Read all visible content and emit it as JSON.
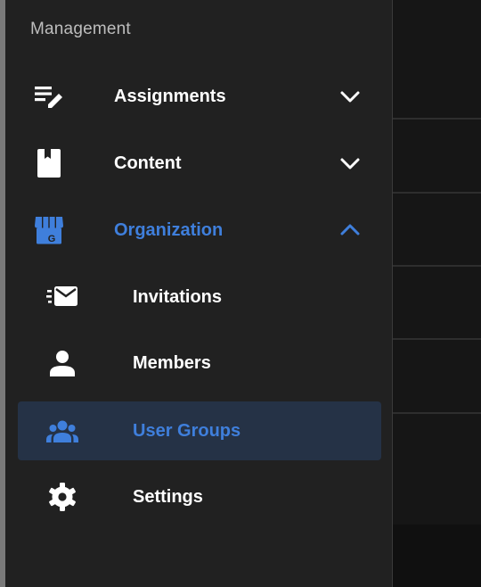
{
  "colors": {
    "accent": "#3f7fdc",
    "active_bg": "#253246",
    "drawer_bg": "#212121",
    "text": "#ffffff",
    "section_title": "#bdbdbd"
  },
  "drawer": {
    "section_title": "Management",
    "items": [
      {
        "label": "Assignments",
        "icon": "assignment-edit-icon",
        "expanded": false
      },
      {
        "label": "Content",
        "icon": "bookmark-icon",
        "expanded": false
      },
      {
        "label": "Organization",
        "icon": "storefront-icon",
        "expanded": true,
        "subitems": [
          {
            "label": "Invitations",
            "icon": "send-mail-icon"
          },
          {
            "label": "Members",
            "icon": "person-icon"
          },
          {
            "label": "User Groups",
            "icon": "group-icon",
            "selected": true
          },
          {
            "label": "Settings",
            "icon": "gear-icon"
          }
        ]
      }
    ]
  }
}
